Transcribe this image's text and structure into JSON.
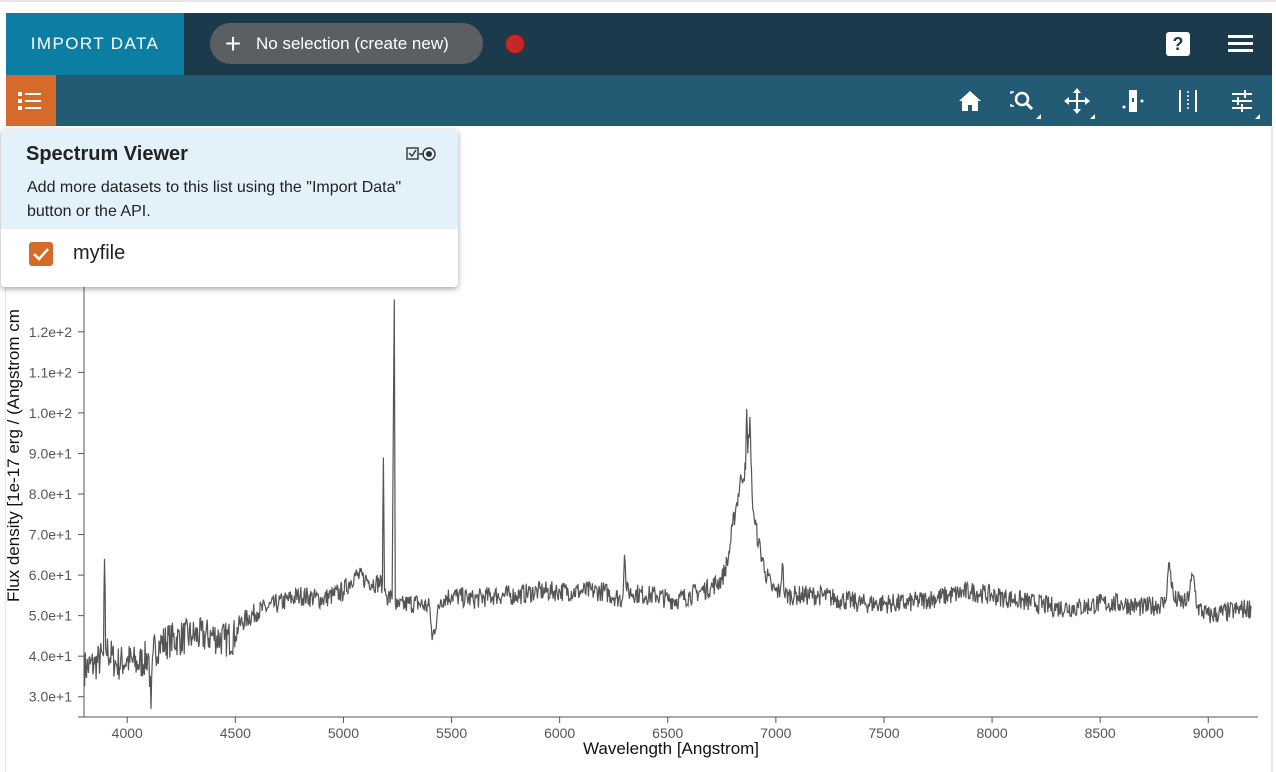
{
  "header": {
    "import_label": "IMPORT DATA",
    "selection_label": "No selection (create new)",
    "help_label": "?",
    "record_color": "#c62828",
    "icons": [
      "plus-icon",
      "help-icon",
      "hamburger-menu-icon"
    ]
  },
  "toolbar": {
    "layer_icon": "layer-list-icon",
    "tools": [
      "home-icon",
      "zoom-box-icon",
      "pan-zoom-icon",
      "x-range-icon",
      "range-select-icon",
      "options-sliders-icon"
    ]
  },
  "popup": {
    "title": "Spectrum Viewer",
    "description": "Add more datasets to this list using the \"Import Data\" button or the API.",
    "item_label": "myfile",
    "item_checked": true,
    "header_icon": "toggle-visibility-icon"
  },
  "colors": {
    "header_bg": "#1b3a4b",
    "import_bg": "#0d7ea3",
    "toolbar_bg": "#235a74",
    "accent": "#d66a2a",
    "popup_head_bg": "#e3f1fb",
    "spectrum": "#555555"
  },
  "chart_data": {
    "type": "line",
    "xlabel": "Wavelength [Angstrom]",
    "ylabel": "Flux density [1e-17 erg / (Angstrom cm",
    "xlim": [
      3800,
      9230
    ],
    "ylim": [
      25,
      135
    ],
    "x_ticks": [
      4000,
      4500,
      5000,
      5500,
      6000,
      6500,
      7000,
      7500,
      8000,
      8500,
      9000
    ],
    "x_tick_labels": [
      "4000",
      "4500",
      "5000",
      "5500",
      "6000",
      "6500",
      "7000",
      "7500",
      "8000",
      "8500",
      "9000"
    ],
    "y_ticks": [
      30,
      40,
      50,
      60,
      70,
      80,
      90,
      100,
      110,
      120
    ],
    "y_tick_labels": [
      "3.0e+1",
      "4.0e+1",
      "5.0e+1",
      "6.0e+1",
      "7.0e+1",
      "8.0e+1",
      "9.0e+1",
      "1.0e+2",
      "1.1e+2",
      "1.2e+2"
    ],
    "grid": false,
    "series": [
      {
        "x": [
          3800,
          3850,
          3890,
          3895,
          3900,
          3950,
          4000,
          4050,
          4100,
          4110,
          4120,
          4150,
          4200,
          4300,
          4400,
          4450,
          4500,
          4520,
          4600,
          4700,
          4800,
          4900,
          4950,
          5000,
          5050,
          5100,
          5150,
          5180,
          5185,
          5190,
          5200,
          5225,
          5235,
          5240,
          5250,
          5300,
          5350,
          5400,
          5410,
          5450,
          5500,
          5600,
          5700,
          5800,
          5900,
          6000,
          6100,
          6200,
          6290,
          6300,
          6310,
          6400,
          6450,
          6500,
          6550,
          6600,
          6650,
          6700,
          6750,
          6780,
          6800,
          6820,
          6840,
          6860,
          6865,
          6870,
          6880,
          6885,
          6890,
          6900,
          6920,
          6950,
          6980,
          7000,
          7020,
          7030,
          7040,
          7060,
          7100,
          7200,
          7300,
          7400,
          7500,
          7600,
          7700,
          7800,
          7900,
          8000,
          8100,
          8200,
          8300,
          8400,
          8500,
          8600,
          8700,
          8800,
          8820,
          8840,
          8900,
          8930,
          8950,
          9000,
          9100,
          9200
        ],
        "y": [
          37,
          38,
          40,
          64,
          42,
          38,
          39,
          38,
          40,
          27,
          41,
          43,
          44,
          45,
          45,
          44,
          45,
          48,
          51,
          53,
          55,
          54,
          55,
          56,
          60,
          59,
          58,
          58,
          89,
          56,
          55,
          54,
          128,
          53,
          52,
          53,
          53,
          52,
          44,
          54,
          55,
          54,
          55,
          55,
          56,
          56,
          56,
          56,
          54,
          65,
          56,
          55,
          55,
          54,
          54,
          55,
          56,
          57,
          59,
          64,
          72,
          78,
          84,
          86,
          101,
          90,
          99,
          88,
          80,
          74,
          68,
          61,
          57,
          56,
          56,
          63,
          55,
          55,
          55,
          55,
          54,
          53,
          53,
          53,
          54,
          55,
          56,
          55,
          54,
          53,
          52,
          52,
          53,
          53,
          52,
          53,
          63,
          54,
          53,
          60,
          52,
          50,
          51,
          52
        ]
      }
    ]
  }
}
